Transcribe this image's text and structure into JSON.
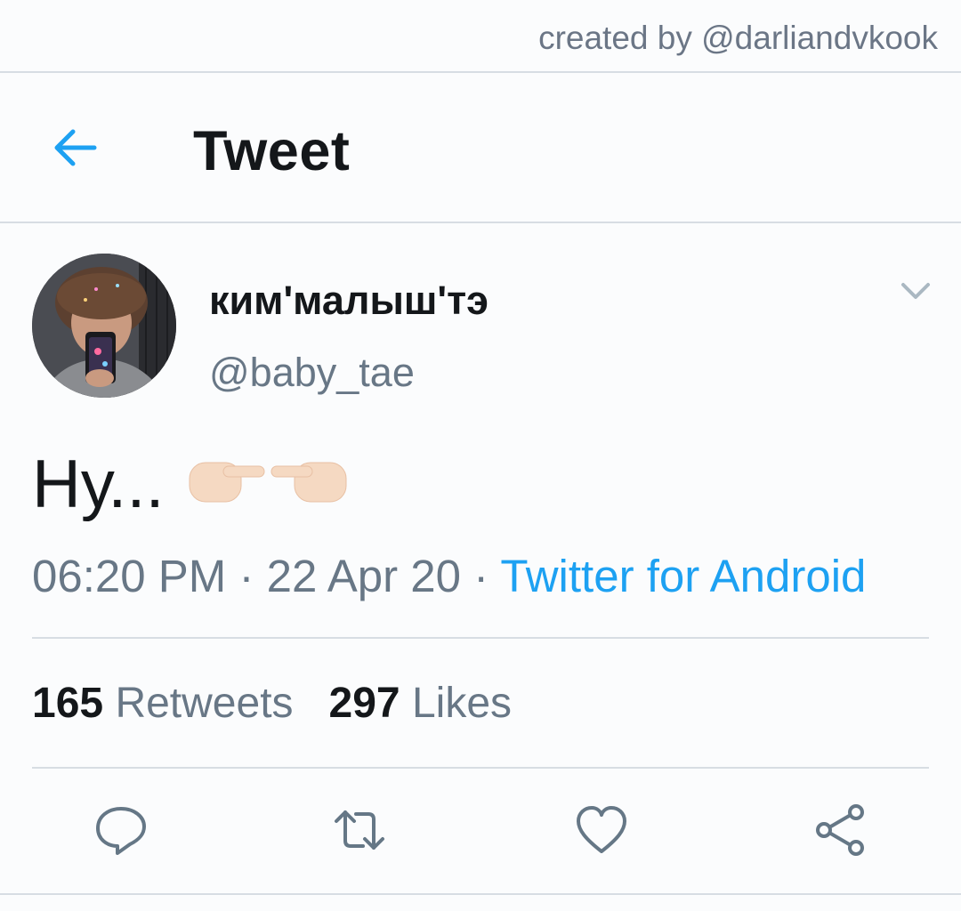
{
  "credit": "created by @darliandvkook",
  "header": {
    "title": "Tweet",
    "back_icon": "arrow-left-icon",
    "accent": "#1da1f2"
  },
  "tweet": {
    "author_name": "ким'малыш'тэ",
    "author_handle": "@baby_tae",
    "text": "Ну...",
    "emoji": "👉👈",
    "time": "06:20 PM",
    "sep1": " · ",
    "date": "22 Apr 20",
    "sep2": " · ",
    "source": "Twitter for Android"
  },
  "stats": {
    "retweets_count": "165",
    "retweets_label": "Retweets",
    "likes_count": "297",
    "likes_label": "Likes"
  },
  "actions": [
    "reply-icon",
    "retweet-icon",
    "like-icon",
    "share-icon"
  ]
}
